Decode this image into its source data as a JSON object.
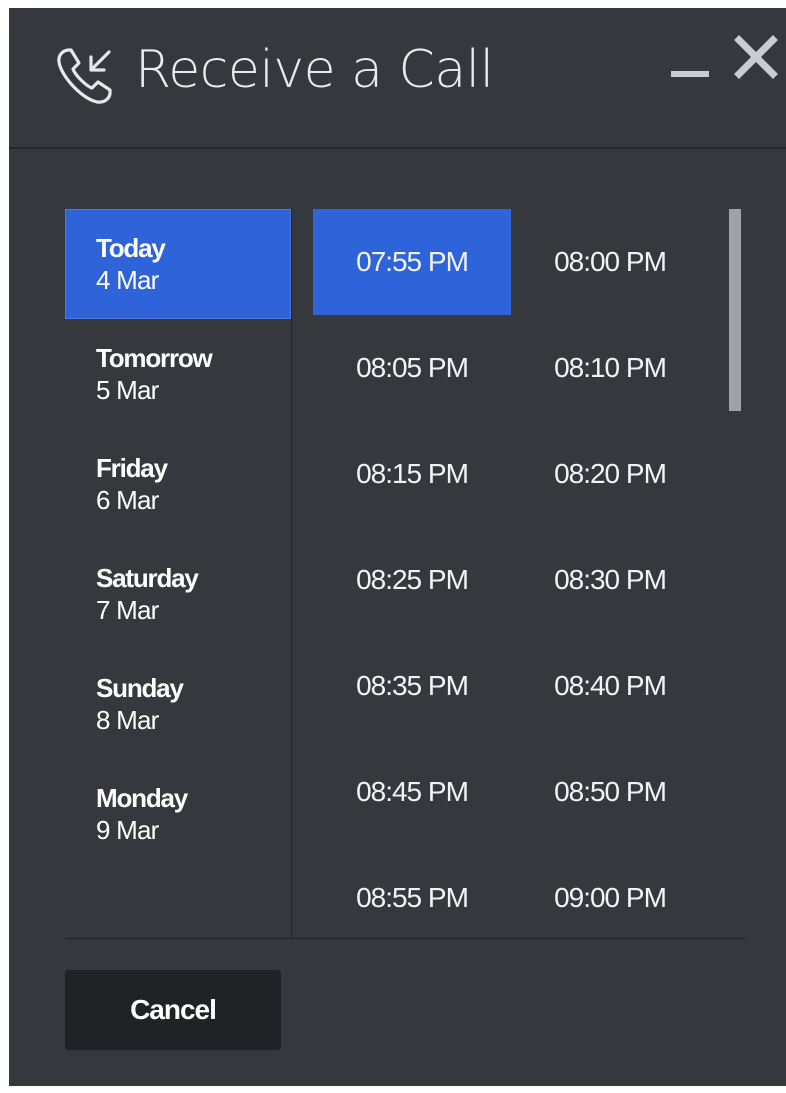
{
  "dialog": {
    "title": "Receive a Call",
    "icons": {
      "phone": "incoming-call-icon",
      "minimize": "minimize-icon",
      "close": "close-icon"
    }
  },
  "days": [
    {
      "name": "Today",
      "date": "4 Mar",
      "selected": true
    },
    {
      "name": "Tomorrow",
      "date": "5 Mar",
      "selected": false
    },
    {
      "name": "Friday",
      "date": "6 Mar",
      "selected": false
    },
    {
      "name": "Saturday",
      "date": "7 Mar",
      "selected": false
    },
    {
      "name": "Sunday",
      "date": "8 Mar",
      "selected": false
    },
    {
      "name": "Monday",
      "date": "9 Mar",
      "selected": false
    }
  ],
  "times": [
    "07:55 PM",
    "08:00 PM",
    "08:05 PM",
    "08:10 PM",
    "08:15 PM",
    "08:20 PM",
    "08:25 PM",
    "08:30 PM",
    "08:35 PM",
    "08:40 PM",
    "08:45 PM",
    "08:50 PM",
    "08:55 PM",
    "09:00 PM"
  ],
  "selected_time": "07:55 PM",
  "footer": {
    "cancel_label": "Cancel"
  },
  "colors": {
    "background": "#35393d",
    "accent": "#2e63d9",
    "button": "#202326",
    "text": "#ffffff"
  }
}
